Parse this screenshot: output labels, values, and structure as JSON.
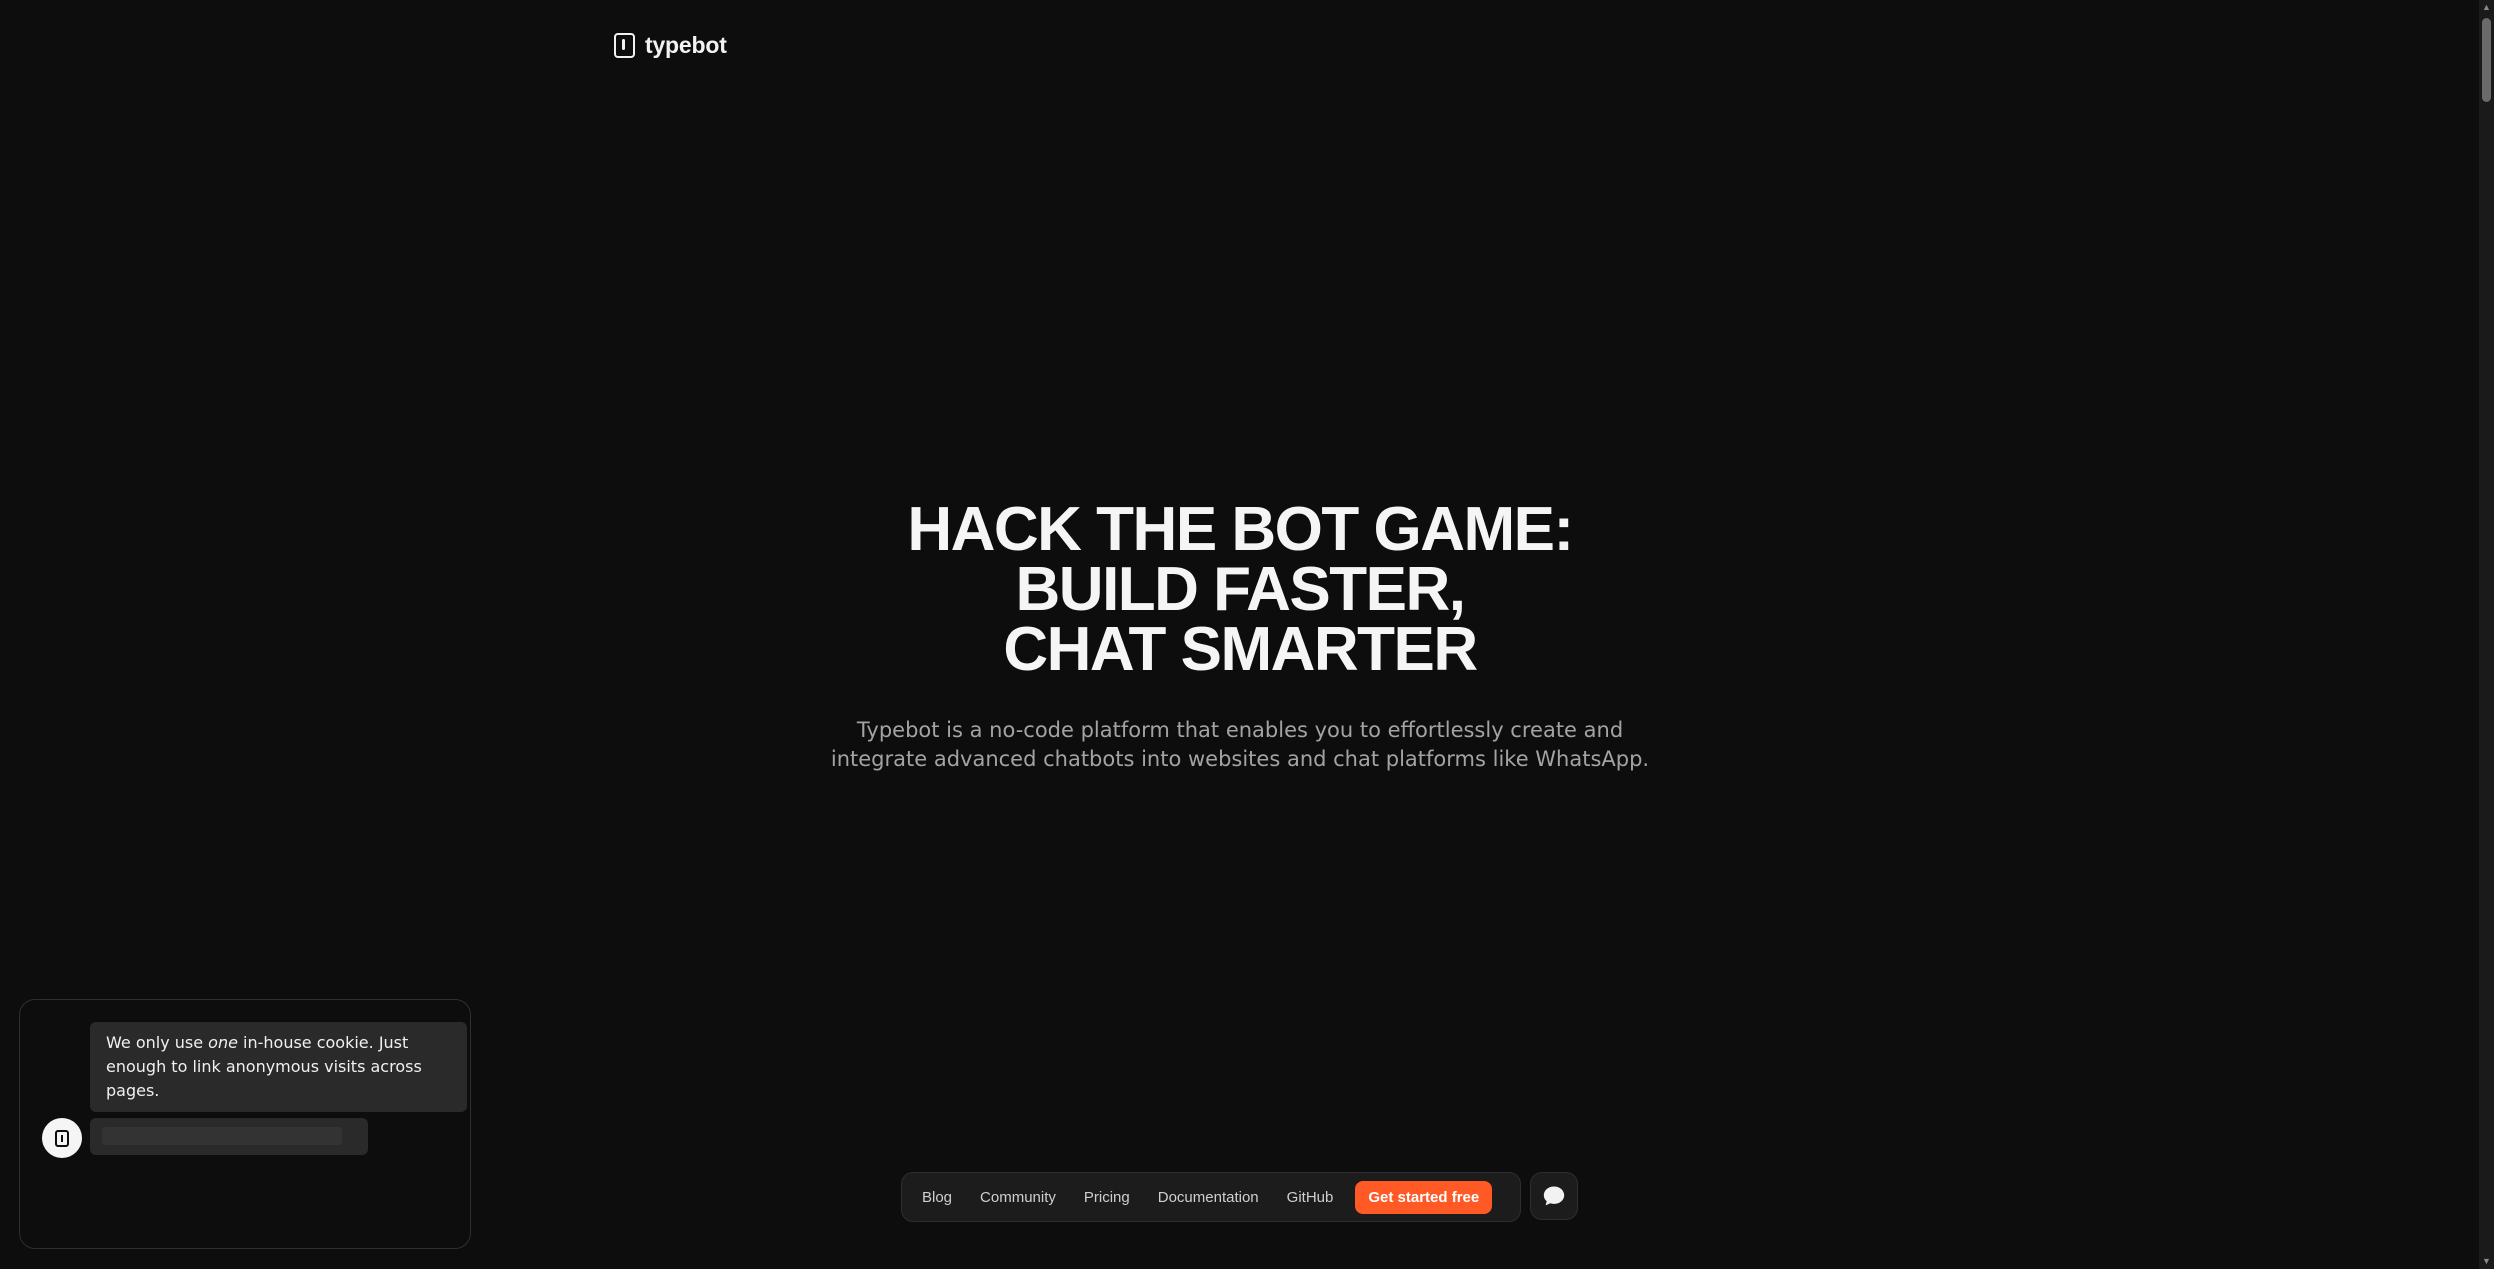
{
  "header": {
    "logo_text": "typebot"
  },
  "hero": {
    "title_lines": [
      "HACK THE BOT GAME:",
      "BUILD FASTER,",
      "CHAT SMARTER"
    ],
    "subtitle_lines": [
      "Typebot is a no-code platform that enables you to effortlessly create and",
      "integrate advanced chatbots into websites and chat platforms like WhatsApp."
    ]
  },
  "nav": {
    "links": [
      "Blog",
      "Community",
      "Pricing",
      "Documentation",
      "GitHub"
    ],
    "cta_label": "Get started free"
  },
  "cookie_bot": {
    "message_before": "We only use ",
    "message_emphasis": "one",
    "message_after": " in-house cookie. Just enough to link anonymous visits across pages."
  },
  "colors": {
    "background": "#0d0d0d",
    "accent": "#ff5925",
    "text_primary": "#f5f5f5",
    "text_muted": "#a3a3a3"
  },
  "icons": {
    "logo": "typebot-logo-icon",
    "chat": "chat-bubble-icon"
  }
}
